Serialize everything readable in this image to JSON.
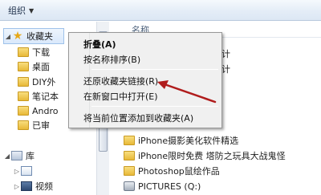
{
  "toolbar": {
    "organize_label": "组织",
    "organize_caret": "▼"
  },
  "nav": {
    "favorites": {
      "label": "收藏夹"
    },
    "items": [
      {
        "label": "下载",
        "icon": "folder-icon"
      },
      {
        "label": "桌面",
        "icon": "folder-icon"
      },
      {
        "label": "DIY外",
        "icon": "folder-icon"
      },
      {
        "label": "笔记本",
        "icon": "folder-icon"
      },
      {
        "label": "Andro",
        "icon": "folder-icon"
      },
      {
        "label": "已审",
        "icon": "folder-icon"
      }
    ],
    "library": {
      "label": "库"
    },
    "library_items": [
      {
        "label": "",
        "icon": "document-icon"
      },
      {
        "label": "视频",
        "icon": "video-icon"
      }
    ]
  },
  "main": {
    "column_name": "名称",
    "files": [
      {
        "label": "计",
        "icon": "folder-icon"
      },
      {
        "label": "计",
        "icon": "folder-icon"
      },
      {
        "label": "iPhone摄影美化软件精选",
        "icon": "folder-icon"
      },
      {
        "label": "iPhone限时免费 塔防之玩具大战鬼怪",
        "icon": "folder-icon"
      },
      {
        "label": "Photoshop鼠绘作品",
        "icon": "folder-icon"
      },
      {
        "label": "PICTURES (Q:)",
        "icon": "drive-icon"
      }
    ]
  },
  "context_menu": {
    "items": [
      {
        "label": "折叠(A)"
      },
      {
        "label": "按名称排序(B)"
      },
      {
        "label": "还原收藏夹链接(R)"
      },
      {
        "label": "在新窗口中打开(E)"
      },
      {
        "label": "将当前位置添加到收藏夹(A)"
      }
    ]
  },
  "colors": {
    "arrow": "#b01c1c",
    "selection": "#d9e8fb"
  }
}
